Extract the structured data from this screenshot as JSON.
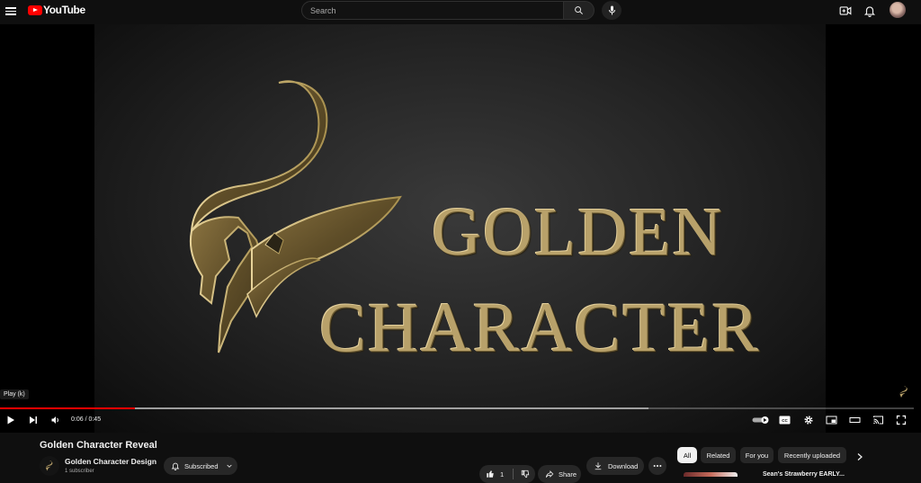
{
  "header": {
    "logo_text": "YouTube",
    "search_placeholder": "Search"
  },
  "player": {
    "video_text_line1": "GOLDEN",
    "video_text_line2": "CHARACTER",
    "tooltip": "Play (k)",
    "time_display": "0:06 / 0:45",
    "progress_played_fraction": 0.148,
    "progress_buffered_fraction": 0.71
  },
  "video": {
    "title": "Golden Character Reveal",
    "channel_name": "Golden Character Design",
    "subscriber_count": "1 subscriber",
    "subscribed_label": "Subscribed",
    "like_count": "1",
    "share_label": "Share",
    "download_label": "Download"
  },
  "chips": [
    {
      "label": "All",
      "active": true
    },
    {
      "label": "Related",
      "active": false
    },
    {
      "label": "For you",
      "active": false
    },
    {
      "label": "Recently uploaded",
      "active": false
    }
  ],
  "recommendation": {
    "title_partial": "Sean's Strawberry EARLY..."
  },
  "colors": {
    "accent": "#ff0000",
    "gold": "#b8a16a",
    "background": "#0f0f0f"
  }
}
